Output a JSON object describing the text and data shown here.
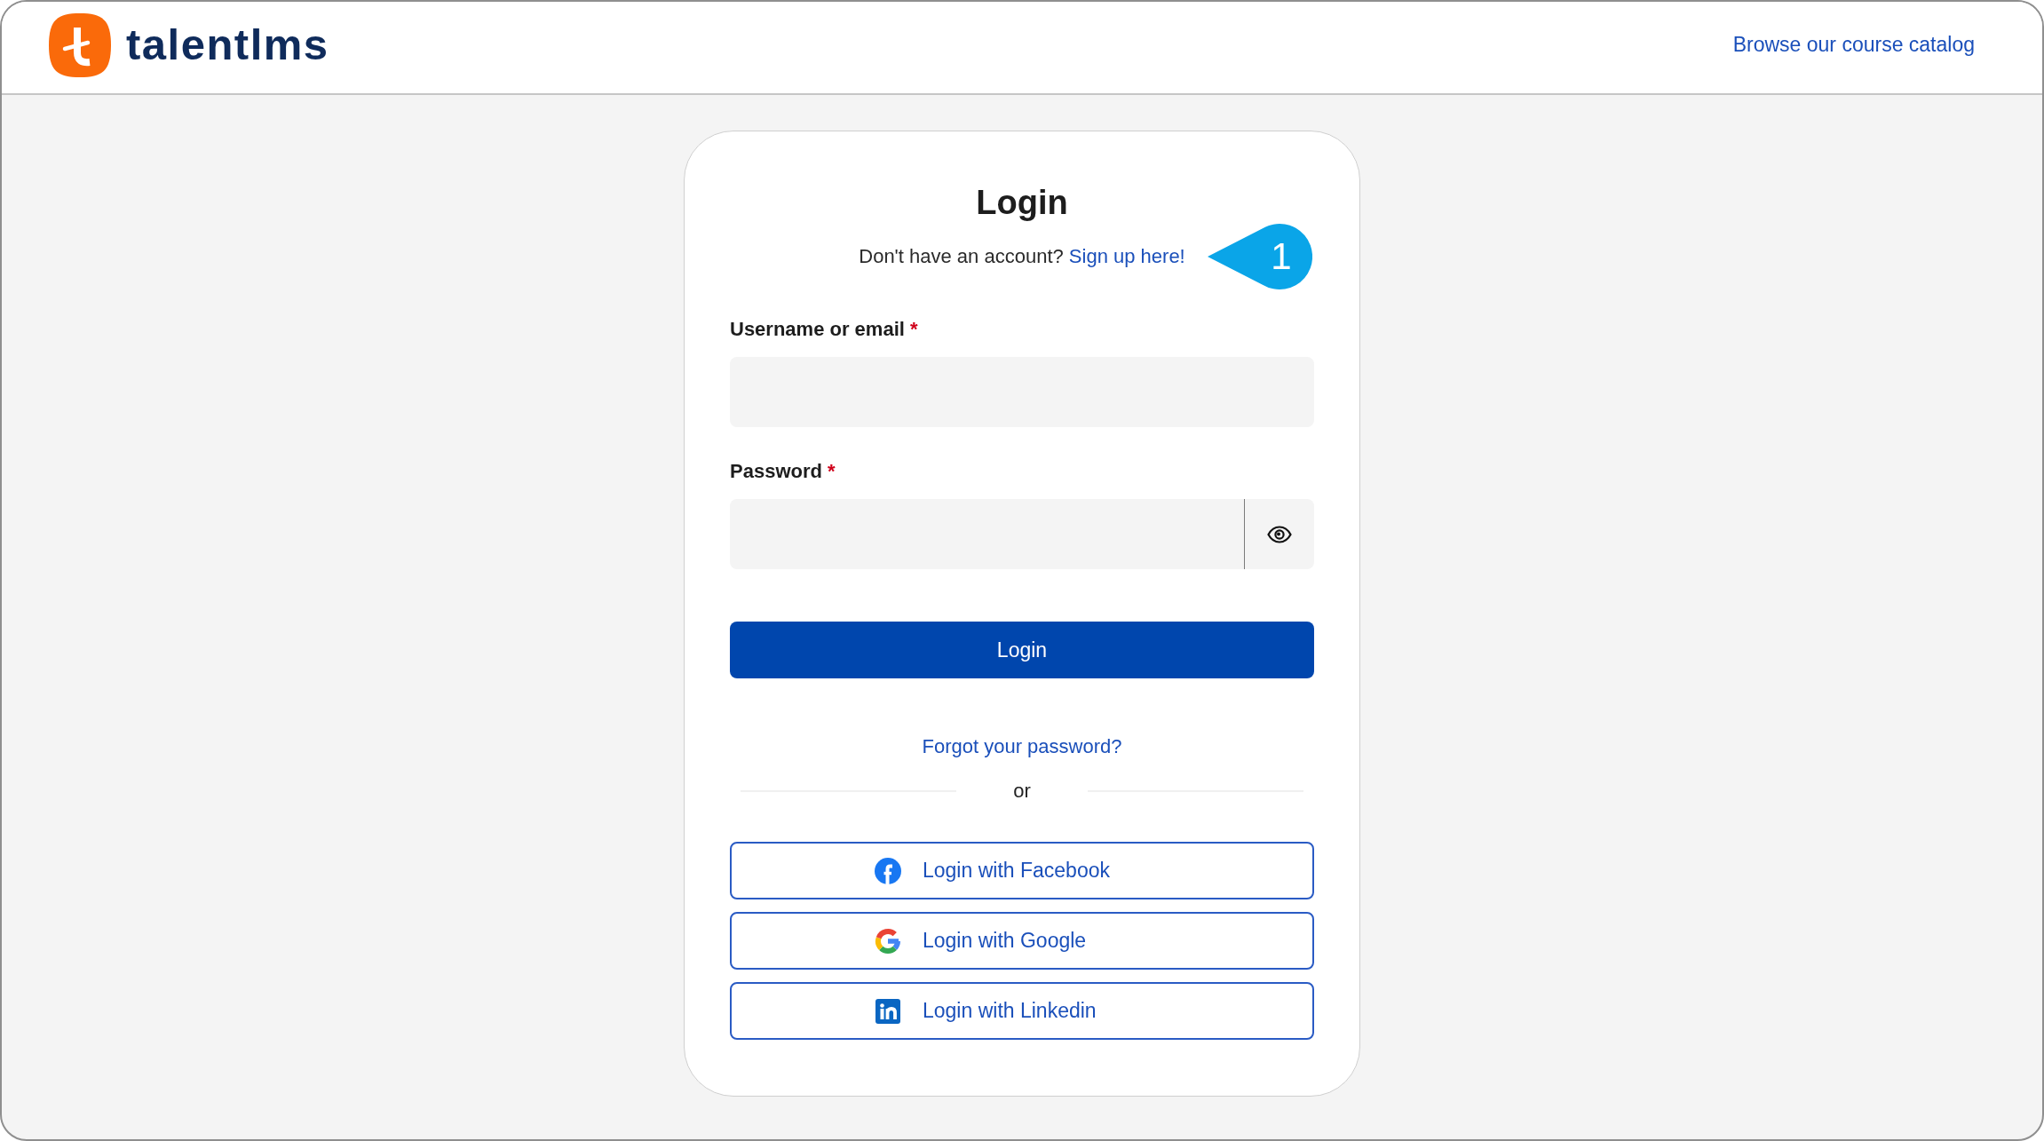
{
  "header": {
    "logo_text": "talentlms",
    "catalog_link": "Browse our course catalog"
  },
  "login_card": {
    "title": "Login",
    "signup_prompt": "Don't have an account?",
    "signup_link": "Sign up here!",
    "callout": {
      "label": "1"
    },
    "fields": [
      {
        "kind": "text",
        "label": "Username or email",
        "required_mark": "*"
      },
      {
        "kind": "password",
        "label": "Password",
        "required_mark": "*"
      }
    ],
    "submit_button": "Login",
    "forgot_link": "Forgot your password?",
    "divider_text": "or",
    "social_buttons": [
      {
        "kind": "facebook",
        "label": "Login with Facebook"
      },
      {
        "kind": "google",
        "label": "Login with Google"
      },
      {
        "kind": "linkedin",
        "label": "Login with Linkedin"
      }
    ]
  }
}
